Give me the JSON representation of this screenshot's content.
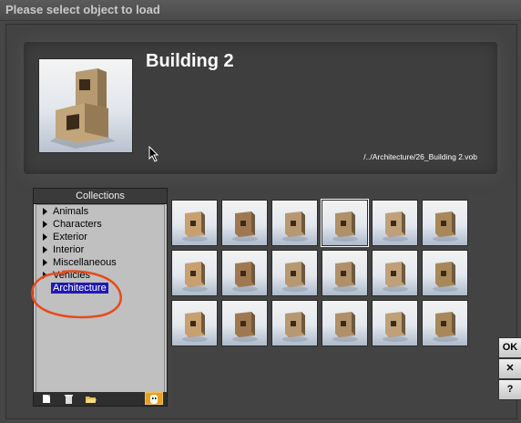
{
  "window": {
    "title": "Please select object to load"
  },
  "preview": {
    "object_name": "Building 2",
    "path": "/../Architecture/26_Building 2.vob"
  },
  "collections": {
    "header": "Collections",
    "items": [
      {
        "label": "Animals",
        "expandable": true
      },
      {
        "label": "Characters",
        "expandable": true
      },
      {
        "label": "Exterior",
        "expandable": true
      },
      {
        "label": "Interior",
        "expandable": true
      },
      {
        "label": "Miscellaneous",
        "expandable": true
      },
      {
        "label": "Vehicles",
        "expandable": true
      },
      {
        "label": "Architecture",
        "expandable": false,
        "selected": true
      }
    ],
    "toolbar_icons": [
      "new-icon",
      "trash-icon",
      "open-folder-icon",
      "ghost-icon"
    ]
  },
  "thumbnails": {
    "rows": 3,
    "cols": 6,
    "selected_index": 3
  },
  "buttons": {
    "ok": "OK",
    "close": "✕",
    "help": "?"
  }
}
